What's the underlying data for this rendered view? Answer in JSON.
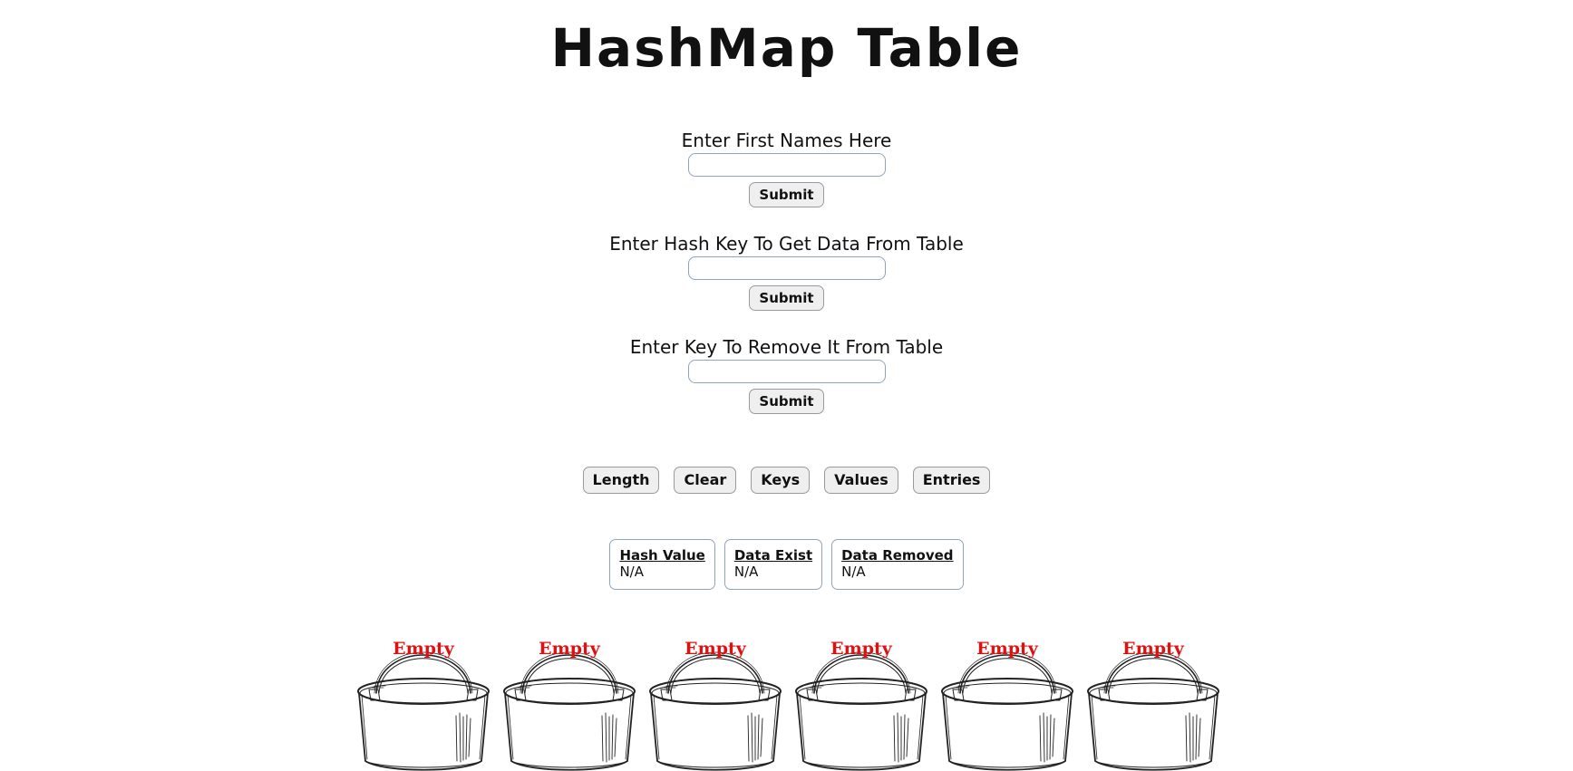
{
  "page": {
    "title": "HashMap Table"
  },
  "forms": {
    "insert": {
      "label": "Enter First Names Here",
      "value": "",
      "placeholder": "",
      "submit_label": "Submit"
    },
    "get": {
      "label": "Enter Hash Key To Get Data From Table",
      "value": "",
      "placeholder": "",
      "submit_label": "Submit"
    },
    "remove": {
      "label": "Enter Key To Remove It From Table",
      "value": "",
      "placeholder": "",
      "submit_label": "Submit"
    }
  },
  "actions": {
    "length": "Length",
    "clear": "Clear",
    "keys": "Keys",
    "values": "Values",
    "entries": "Entries"
  },
  "info": {
    "hash_value": {
      "heading": "Hash Value",
      "value": "N/A"
    },
    "data_exist": {
      "heading": "Data Exist",
      "value": "N/A"
    },
    "data_removed": {
      "heading": "Data Removed",
      "value": "N/A"
    }
  },
  "buckets": [
    {
      "label": "Empty",
      "icon": "bucket-icon"
    },
    {
      "label": "Empty",
      "icon": "bucket-icon"
    },
    {
      "label": "Empty",
      "icon": "bucket-icon"
    },
    {
      "label": "Empty",
      "icon": "bucket-icon"
    },
    {
      "label": "Empty",
      "icon": "bucket-icon"
    },
    {
      "label": "Empty",
      "icon": "bucket-icon"
    }
  ],
  "colors": {
    "empty_label": "#e01010",
    "input_border": "#8fa3c0",
    "button_bg": "#efefef"
  }
}
